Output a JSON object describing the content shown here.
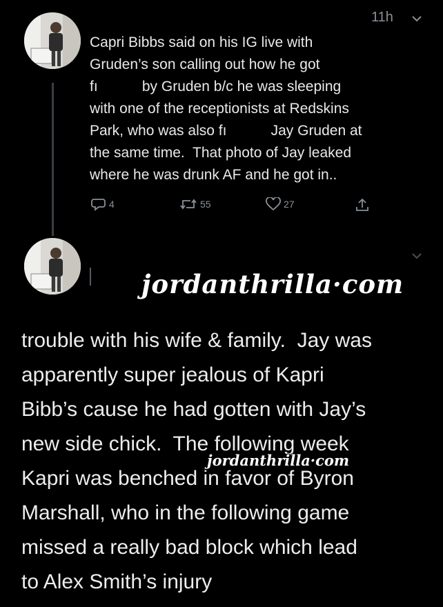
{
  "colors": {
    "background": "#000000",
    "text": "#e9e9e9",
    "muted": "#8a9199",
    "thread_line": "#3a3f45"
  },
  "tweet1": {
    "timestamp": "11h",
    "lines": [
      "Capri Bibbs said on his IG live with",
      "Gruden’s son calling out how he got",
      "fı           by Gruden b/c he was sleeping",
      "with one of the receptionists at Redskins",
      "Park, who was also fı           Jay Gruden at",
      "the same time.  That photo of Jay leaked",
      "where he was drunk AF and he got in.."
    ],
    "actions": {
      "reply_count": "4",
      "retweet_count": "55",
      "like_count": "27"
    }
  },
  "tweet2": {
    "lines": [
      "trouble with his wife & family.  Jay was",
      "apparently super jealous of Kapri",
      "Bibb’s cause he had gotten with Jay’s",
      "new side chick.  The following week",
      "Kapri was benched in favor of Byron",
      "Marshall, who in the following game",
      "missed a really bad block which lead",
      "to Alex Smith’s injury"
    ]
  },
  "watermarks": {
    "large": "jordanthrilla·com",
    "small": "jordanthrilla·com"
  },
  "icons": {
    "reply": "reply-icon",
    "retweet": "retweet-icon",
    "like": "heart-icon",
    "share": "share-icon",
    "more": "chevron-down-icon"
  }
}
